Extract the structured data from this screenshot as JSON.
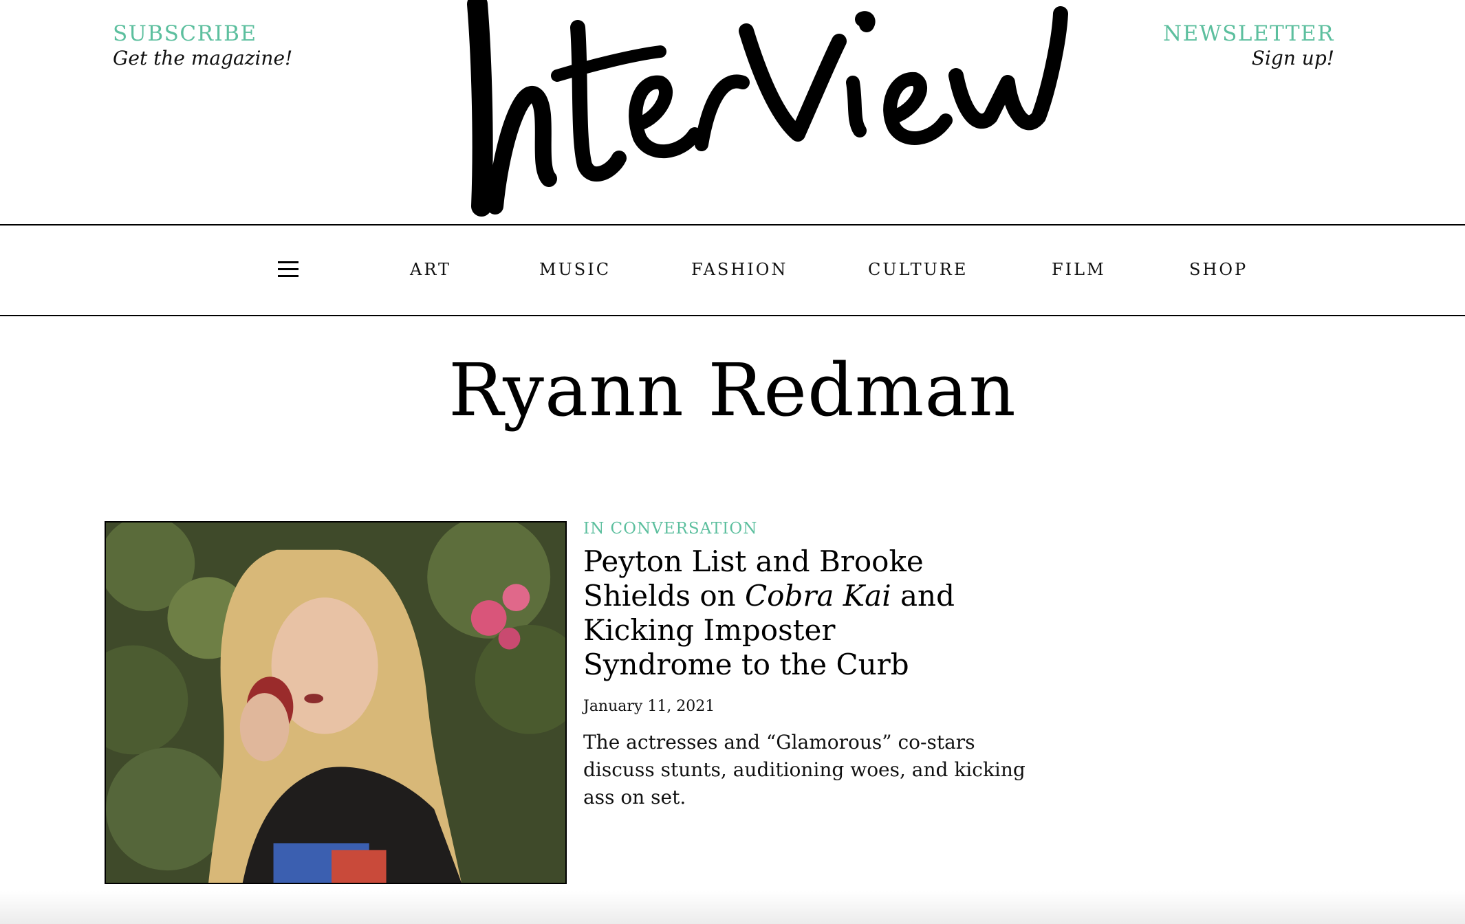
{
  "header": {
    "subscribe": {
      "title": "SUBSCRIBE",
      "subtitle": "Get the magazine!"
    },
    "newsletter": {
      "title": "NEWSLETTER",
      "subtitle": "Sign up!"
    },
    "logo_text": "Interview"
  },
  "nav": {
    "menu_icon": "hamburger-menu-icon",
    "items": [
      "ART",
      "MUSIC",
      "FASHION",
      "CULTURE",
      "FILM",
      "SHOP"
    ]
  },
  "page": {
    "title": "Ryann Redman"
  },
  "article": {
    "kicker": "IN CONVERSATION",
    "headline_part1": "Peyton List and Brooke Shields on ",
    "headline_italic": "Cobra Kai",
    "headline_part2": " and Kicking Imposter Syndrome to the Curb",
    "date": "January 11, 2021",
    "excerpt": "The actresses and “Glamorous” co-stars discuss stunts, auditioning woes, and kicking ass on set."
  },
  "colors": {
    "accent": "#5cbf9e",
    "text": "#000000",
    "background": "#ffffff"
  }
}
